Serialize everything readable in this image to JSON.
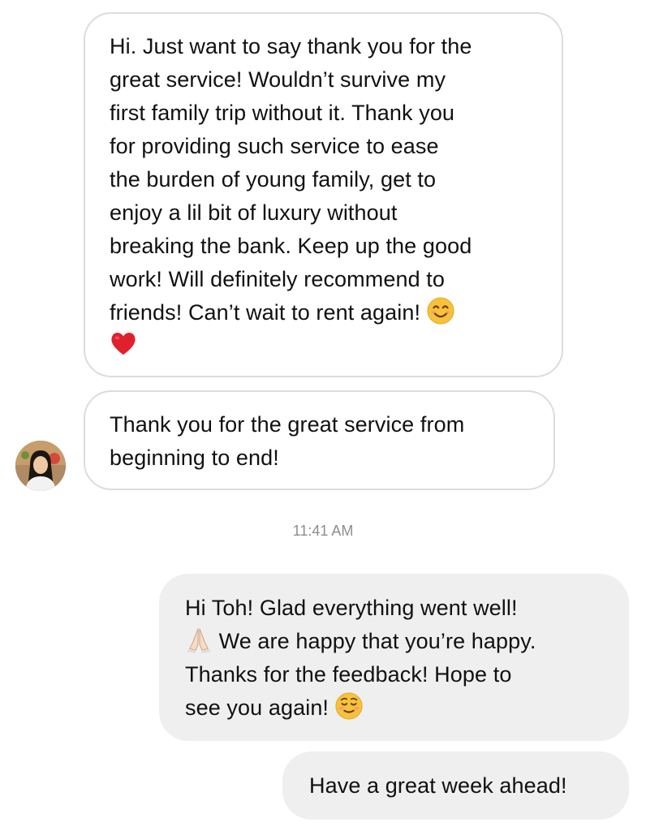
{
  "thread": {
    "messages": [
      {
        "sender": "contact",
        "text": "Hi. Just want to say thank you for the\ngreat service! Wouldn’t survive my\nfirst family trip without it. Thank you\nfor providing such service to ease\nthe burden of young family, get to\nenjoy a lil bit of luxury without\nbreaking the bank. Keep up the good\nwork! Will definitely recommend to\nfriends! Can’t wait to rent again! ",
        "emojis": [
          "smiling-face-emoji",
          "red-heart-emoji"
        ]
      },
      {
        "sender": "contact",
        "text": "Thank you for the great service from\nbeginning to end!"
      },
      {
        "sender": "me",
        "text_before": "Hi Toh! Glad everything went well!\n",
        "text_after": " We are happy that you’re happy.\nThanks for the feedback! Hope to\nsee you again! ",
        "emojis": [
          "folded-hands-emoji",
          "smiling-face-blush-emoji"
        ]
      },
      {
        "sender": "me",
        "text": "Have a great week ahead!"
      }
    ],
    "timestamp": "11:41 AM"
  },
  "colors": {
    "incoming_bubble_bg": "#ffffff",
    "incoming_bubble_border": "#dcdcdc",
    "outgoing_bubble_bg": "#efefef",
    "text": "#111111",
    "timestamp": "#8e8e8e",
    "heart": "#e0202d",
    "emoji_face": "#f7c23a"
  },
  "avatar": {
    "icon": "contact-avatar"
  }
}
